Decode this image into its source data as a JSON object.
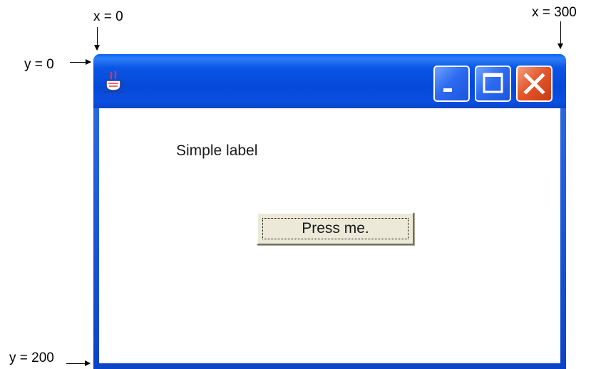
{
  "annotations": {
    "x0": "x = 0",
    "x300": "x = 300",
    "y0": "y = 0",
    "y200": "y = 200"
  },
  "window": {
    "title": "",
    "app_icon": "java-coffee-cup-icon",
    "controls": [
      "minimize-icon",
      "maximize-icon",
      "close-icon"
    ],
    "colors": {
      "titlebar": "#0449d9",
      "close": "#e4582e",
      "client": "#ffffff"
    }
  },
  "content": {
    "label": "Simple label",
    "button": "Press me."
  }
}
